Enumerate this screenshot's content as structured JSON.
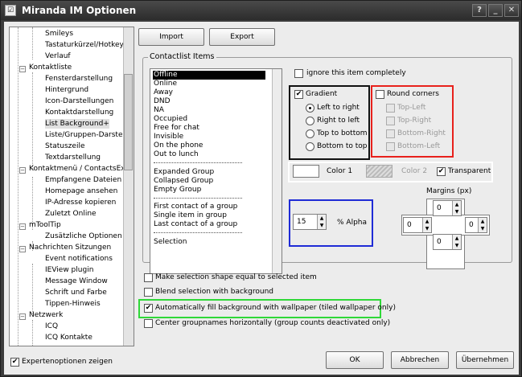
{
  "title": "Miranda IM Optionen",
  "tree": {
    "items": [
      "Smileys",
      "Tastaturkürzel/Hotkeys",
      "Verlauf",
      "Kontaktliste",
      "Fensterdarstellung",
      "Hintergrund",
      "Icon-Darstellungen",
      "Kontaktdarstellung",
      "List Background+",
      "Liste/Gruppen-Darstellung",
      "Statuszeile",
      "Textdarstellung",
      "Kontaktmenü / ContactsEx",
      "Empfangene Dateien an",
      "Homepage ansehen",
      "IP-Adresse kopieren",
      "Zuletzt Online",
      "mToolTip",
      "Zusätzliche Optionen",
      "Nachrichten Sitzungen",
      "Event notifications",
      "IEView plugin",
      "Message Window",
      "Schrift und Farbe",
      "Tippen-Hinweis",
      "Netzwerk",
      "ICQ",
      "ICQ Kontakte"
    ]
  },
  "buttons": {
    "import": "Import",
    "export": "Export",
    "ok": "OK",
    "cancel": "Abbrechen",
    "apply": "Übernehmen"
  },
  "contactlist": {
    "group_label": "Contactlist Items",
    "items": [
      "Offline",
      "Online",
      "Away",
      "DND",
      "NA",
      "Occupied",
      "Free for chat",
      "Invisible",
      "On the phone",
      "Out to lunch",
      "Expanded Group",
      "Collapsed Group",
      "Empty Group",
      "First contact of a group",
      "Single item in group",
      "Last contact of a group",
      "Selection"
    ],
    "ignore": "ignore this item completely",
    "gradient": "Gradient",
    "left_to_right": "Left to right",
    "right_to_left": "Right to left",
    "top_to_bottom": "Top to bottom",
    "bottom_to_top": "Bottom to top",
    "round_corners": "Round corners",
    "top_left": "Top-Left",
    "top_right": "Top-Right",
    "bottom_right": "Bottom-Right",
    "bottom_left": "Bottom-Left",
    "color1": "Color 1",
    "color2": "Color 2",
    "transparent": "Transparent",
    "alpha_value": "15",
    "alpha_label": "% Alpha",
    "margins_label": "Margins (px)",
    "margin_top": "0",
    "margin_left": "0",
    "margin_right": "0",
    "margin_bottom": "0"
  },
  "options": {
    "opt1": "Make selection shape equal to selected item",
    "opt2": "Blend selection with background",
    "opt3": "Automatically fill background with wallpaper (tiled wallpaper only)",
    "opt4": "Center groupnames horizontally (group counts deactivated only)"
  },
  "expert": "Expertenoptionen zeigen",
  "colors": {
    "black_box": "#111111",
    "red_box": "#e8211c",
    "blue_box": "#1f2bd6",
    "green_box": "#2fd838",
    "white_box": "#ffffff"
  }
}
